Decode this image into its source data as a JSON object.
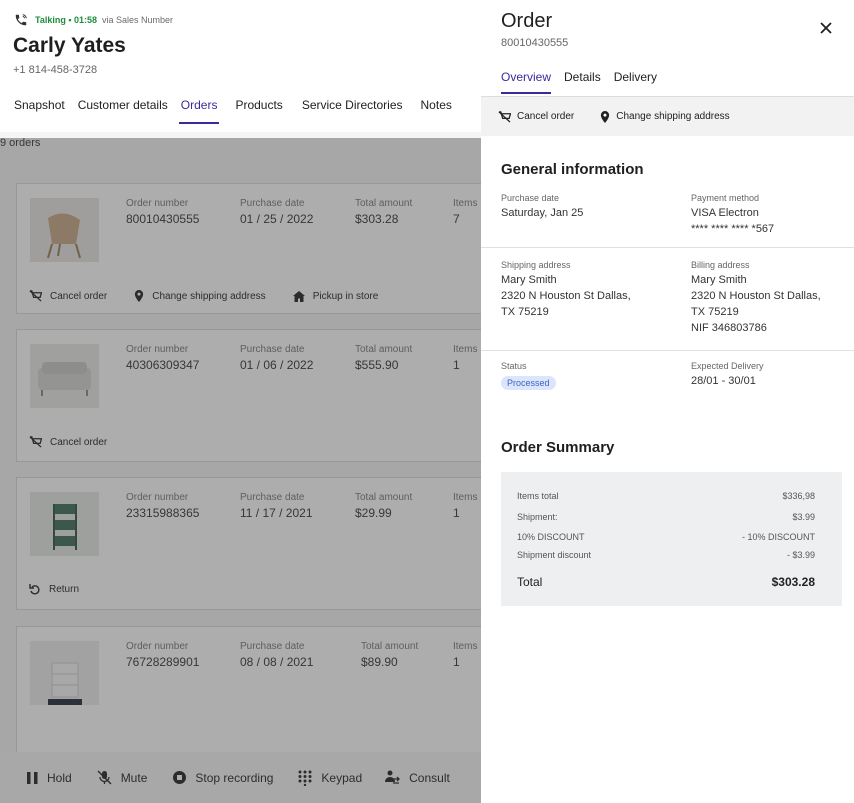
{
  "call": {
    "status": "Talking • 01:58",
    "via": "via Sales Number",
    "caller_name": "Carly Yates",
    "caller_phone": "+1 814-458-3728"
  },
  "left_tabs": [
    {
      "label": "Snapshot",
      "active": false
    },
    {
      "label": "Customer details",
      "active": false
    },
    {
      "label": "Orders",
      "active": true
    },
    {
      "label": "Products",
      "active": false
    },
    {
      "label": "Service Directories",
      "active": false
    },
    {
      "label": "Notes",
      "active": false
    }
  ],
  "orders_count": "9 orders",
  "order_labels": {
    "number": "Order number",
    "date": "Purchase date",
    "amount": "Total amount",
    "items": "Items"
  },
  "orders": [
    {
      "number": "80010430555",
      "date": "01 / 25 / 2022",
      "amount": "$303.28",
      "items": "7",
      "image": "chair-photo"
    },
    {
      "number": "40306309347",
      "date": "01 / 06 / 2022",
      "amount": "$555.90",
      "items": "1",
      "image": "sofa-photo"
    },
    {
      "number": "23315988365",
      "date": "11 / 17 / 2021",
      "amount": "$29.99",
      "items": "1",
      "image": "trolley-photo"
    },
    {
      "number": "76728289901",
      "date": "08 / 08 / 2021",
      "amount": "$89.90",
      "items": "1",
      "image": "drawer-unit-photo"
    }
  ],
  "order_actions": {
    "cancel": "Cancel order",
    "change_address": "Change shipping address",
    "pickup": "Pickup in store",
    "return": "Return"
  },
  "call_controls": {
    "hold": "Hold",
    "mute": "Mute",
    "stop_recording": "Stop recording",
    "keypad": "Keypad",
    "consult": "Consult"
  },
  "panel": {
    "title": "Order",
    "order_id": "80010430555",
    "tabs": [
      {
        "label": "Overview",
        "active": true
      },
      {
        "label": "Details",
        "active": false
      },
      {
        "label": "Delivery",
        "active": false
      }
    ],
    "actions": {
      "cancel": "Cancel order",
      "change_address": "Change shipping address"
    },
    "general_title": "General information",
    "purchase_date_label": "Purchase date",
    "purchase_date": "Saturday, Jan 25",
    "payment_label": "Payment method",
    "payment_method": "VISA Electron",
    "card_masked": "**** **** **** *567",
    "shipping_label": "Shipping address",
    "shipping": [
      "Mary Smith",
      "2320 N Houston St Dallas,",
      "TX 75219"
    ],
    "billing_label": "Billing address",
    "billing": [
      "Mary Smith",
      "2320 N Houston St Dallas,",
      "TX 75219",
      "NIF 346803786"
    ],
    "status_label": "Status",
    "status": "Processed",
    "expected_label": "Expected Delivery",
    "expected": "28/01 - 30/01",
    "summary_title": "Order Summary",
    "summary": {
      "items_total_label": "Items total",
      "items_total": "$336,98",
      "shipment_label": "Shipment:",
      "shipment": "$3.99",
      "discount_label": "10% DISCOUNT",
      "discount": "- 10% DISCOUNT",
      "ship_discount_label": "Shipment discount",
      "ship_discount": "- $3.99",
      "total_label": "Total",
      "total": "$303.28"
    }
  },
  "colors": {
    "accent": "#3b2b9a",
    "talking": "#1e8e3e",
    "badge_bg": "#dbe5fb",
    "badge_text": "#3c66c2"
  }
}
